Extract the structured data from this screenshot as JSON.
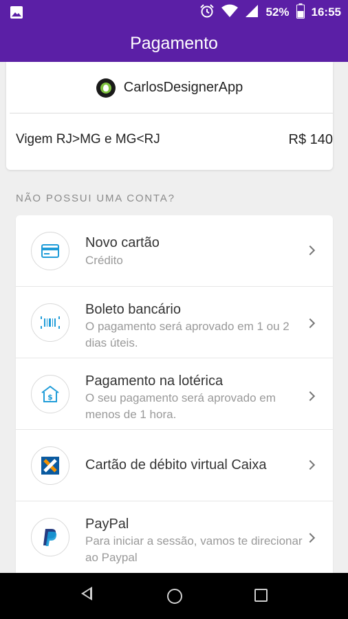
{
  "status_bar": {
    "battery": "52%",
    "time": "16:55",
    "icons": [
      "image-notification-icon",
      "alarm-icon",
      "wifi-icon",
      "signal-icon",
      "battery-icon"
    ]
  },
  "app_bar": {
    "title": "Pagamento"
  },
  "merchant": {
    "name": "CarlosDesignerApp",
    "logo_icon": "merchant-logo-icon"
  },
  "order": {
    "description": "Vigem RJ>MG e MG<RJ",
    "amount": "R$ 140"
  },
  "section": {
    "title": "NÃO POSSUI UMA CONTA?"
  },
  "payment_methods": [
    {
      "title": "Novo cartão",
      "subtitle": "Crédito",
      "icon": "credit-card-icon"
    },
    {
      "title": "Boleto bancário",
      "subtitle": "O pagamento será aprovado em 1 ou 2 dias úteis.",
      "icon": "barcode-icon"
    },
    {
      "title": "Pagamento na lotérica",
      "subtitle": "O seu pagamento será aprovado em menos de 1 hora.",
      "icon": "lottery-store-icon"
    },
    {
      "title": "Cartão de débito virtual Caixa",
      "subtitle": "",
      "icon": "caixa-logo-icon"
    },
    {
      "title": "PayPal",
      "subtitle": "Para iniciar a sessão, vamos te direcionar ao Paypal",
      "icon": "paypal-logo-icon"
    }
  ],
  "colors": {
    "primary": "#5b1fa6",
    "background": "#efefef",
    "card": "#ffffff",
    "icon_blue": "#1f9cd8",
    "caixa_blue": "#0a5aa0",
    "caixa_orange": "#f39200",
    "paypal_dark": "#253b80",
    "paypal_light": "#179bd7"
  }
}
